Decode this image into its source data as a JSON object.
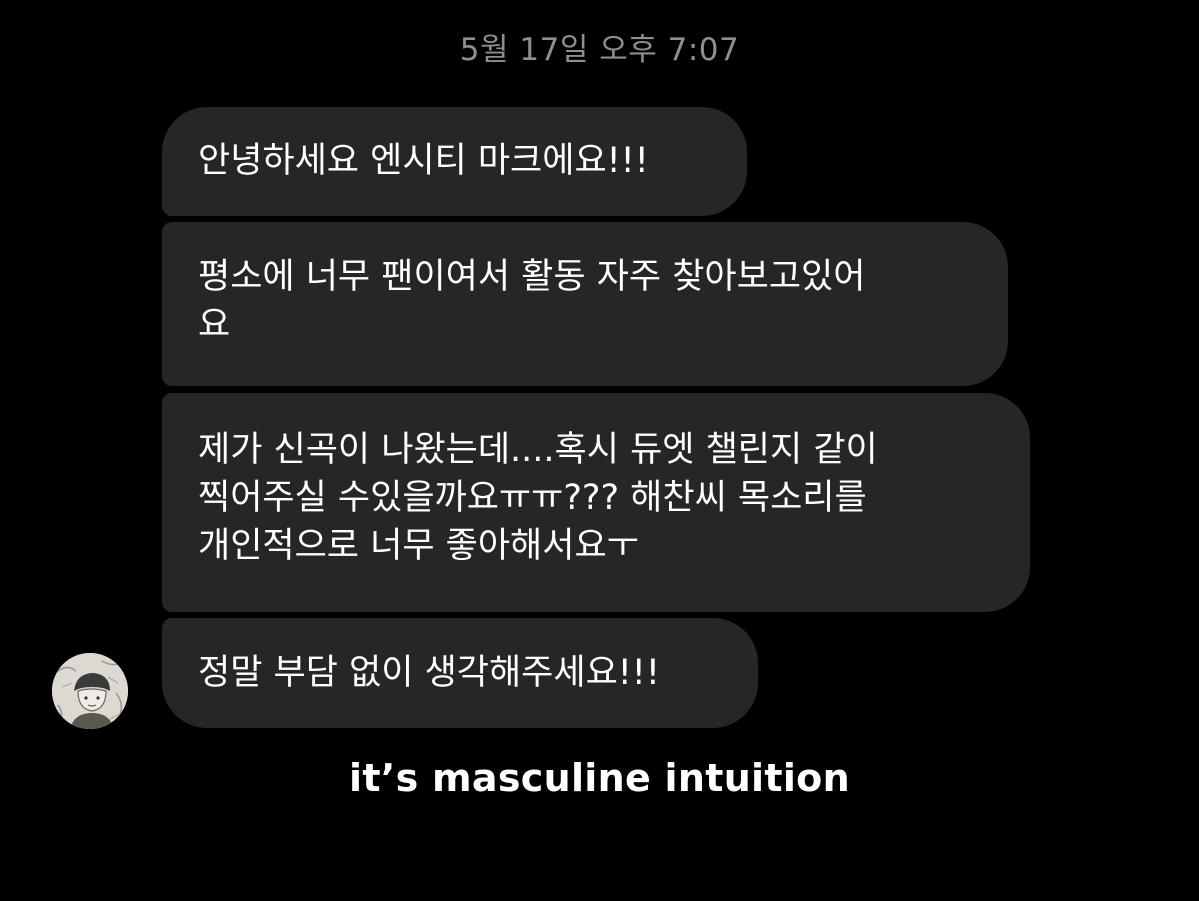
{
  "chat": {
    "timestamp": "5월 17일 오후 7:07",
    "messages": [
      {
        "lines": [
          "안녕하세요 엔시티 마크에요!!!"
        ]
      },
      {
        "lines": [
          "평소에 너무 팬이여서 활동 자주 찾아보고있어",
          "요"
        ]
      },
      {
        "lines": [
          "제가 신곡이 나왔는데....혹시 듀엣 챌린지 같이",
          "찍어주실 수있을까요ㅠㅠ??? 해찬씨 목소리를",
          "개인적으로 너무 좋아해서요ㅜ"
        ]
      },
      {
        "lines": [
          "정말 부담 없이 생각해주세요!!!"
        ]
      }
    ],
    "avatar_icon": "profile-sketch-avatar"
  },
  "caption": "it’s masculine intuition",
  "colors": {
    "background": "#000000",
    "bubble": "#262626",
    "text": "#ffffff",
    "timestamp": "#8e8e93"
  }
}
